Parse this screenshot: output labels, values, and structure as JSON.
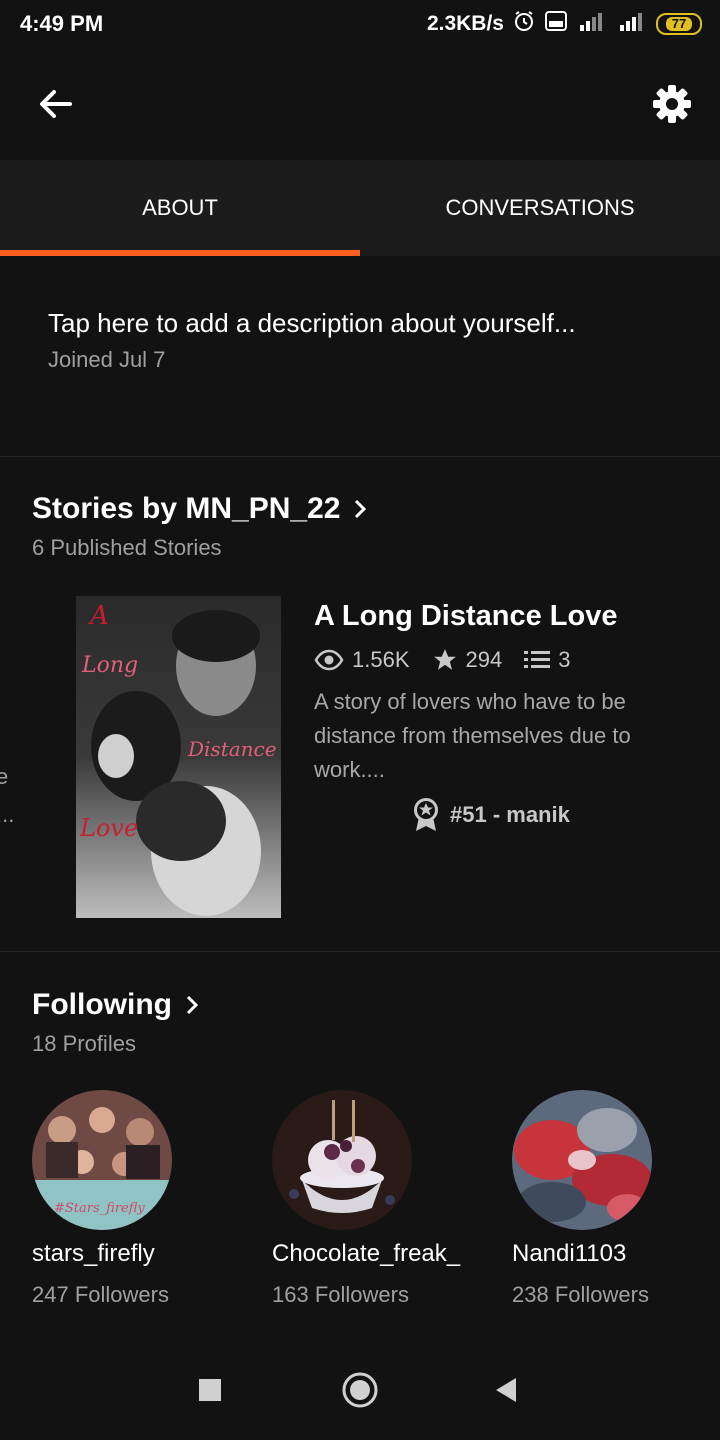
{
  "status_bar": {
    "time": "4:49 PM",
    "network_speed": "2.3KB/s",
    "battery": "77",
    "icons": [
      "alarm-icon",
      "volte-icon",
      "signal-4g-icon",
      "signal-icon",
      "battery-icon"
    ]
  },
  "app_bar": {
    "back_icon": "arrow-left-icon",
    "settings_icon": "gear-icon"
  },
  "tabs": [
    {
      "label": "ABOUT",
      "active": true
    },
    {
      "label": "CONVERSATIONS",
      "active": false
    }
  ],
  "colors": {
    "accent": "#ff6122",
    "background": "#121212",
    "tab_bar": "#1c1c1c",
    "secondary_text": "#a0a0a0"
  },
  "about": {
    "description_prompt": "Tap here to add a description about yourself...",
    "joined": "Joined Jul 7"
  },
  "stories": {
    "title": "Stories by MN_PN_22",
    "subtitle": "6 Published Stories",
    "items": [
      {
        "title": "A Long Distance Love",
        "cover_words": [
          "A",
          "Long",
          "Distance",
          "Love"
        ],
        "reads": "1.56K",
        "votes": "294",
        "parts": "3",
        "description": "A story of lovers who have to be distance from themselves due to work....",
        "rank": "#51 - manik"
      }
    ],
    "edge_fragment": {
      "line1": "e",
      "line2": "..."
    }
  },
  "following": {
    "title": "Following",
    "subtitle": "18 Profiles",
    "profiles": [
      {
        "name": "stars_firefly",
        "followers": "247 Followers",
        "avatar_caption": "#Stars_firefly"
      },
      {
        "name": "Chocolate_freak_",
        "followers": "163 Followers"
      },
      {
        "name": "Nandi1103",
        "followers": "238 Followers"
      }
    ]
  },
  "nav_bar": {
    "icons": [
      "recents-square-icon",
      "home-circle-icon",
      "back-triangle-icon"
    ]
  }
}
